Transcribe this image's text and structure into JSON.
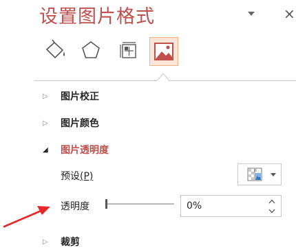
{
  "pane": {
    "title": "设置图片格式",
    "dropdown_icon": "chevron-down-icon",
    "close_label": "×"
  },
  "tabs": [
    {
      "id": "fill-line",
      "icon": "paint-bucket-icon",
      "selected": false
    },
    {
      "id": "effects",
      "icon": "pentagon-icon",
      "selected": false
    },
    {
      "id": "size-properties",
      "icon": "size-properties-icon",
      "selected": false
    },
    {
      "id": "picture",
      "icon": "picture-icon",
      "selected": true
    }
  ],
  "sections": {
    "correction": {
      "arrow": "▷",
      "label": "图片校正",
      "expanded": false
    },
    "color": {
      "arrow": "▷",
      "label": "图片颜色",
      "expanded": false
    },
    "transparency": {
      "arrow": "◢",
      "label": "图片透明度",
      "expanded": true
    },
    "crop": {
      "arrow": "▷",
      "label": "裁剪",
      "expanded": false
    }
  },
  "transparency": {
    "preset_label": "预设",
    "preset_accel": "(P)",
    "transparency_label": "透明度",
    "transparency_value": "0%",
    "slider_level": 0
  },
  "colors": {
    "accent": "#c0504d",
    "selected_tab_bg": "#fce4d6",
    "annotation_arrow": "#e8262b"
  }
}
